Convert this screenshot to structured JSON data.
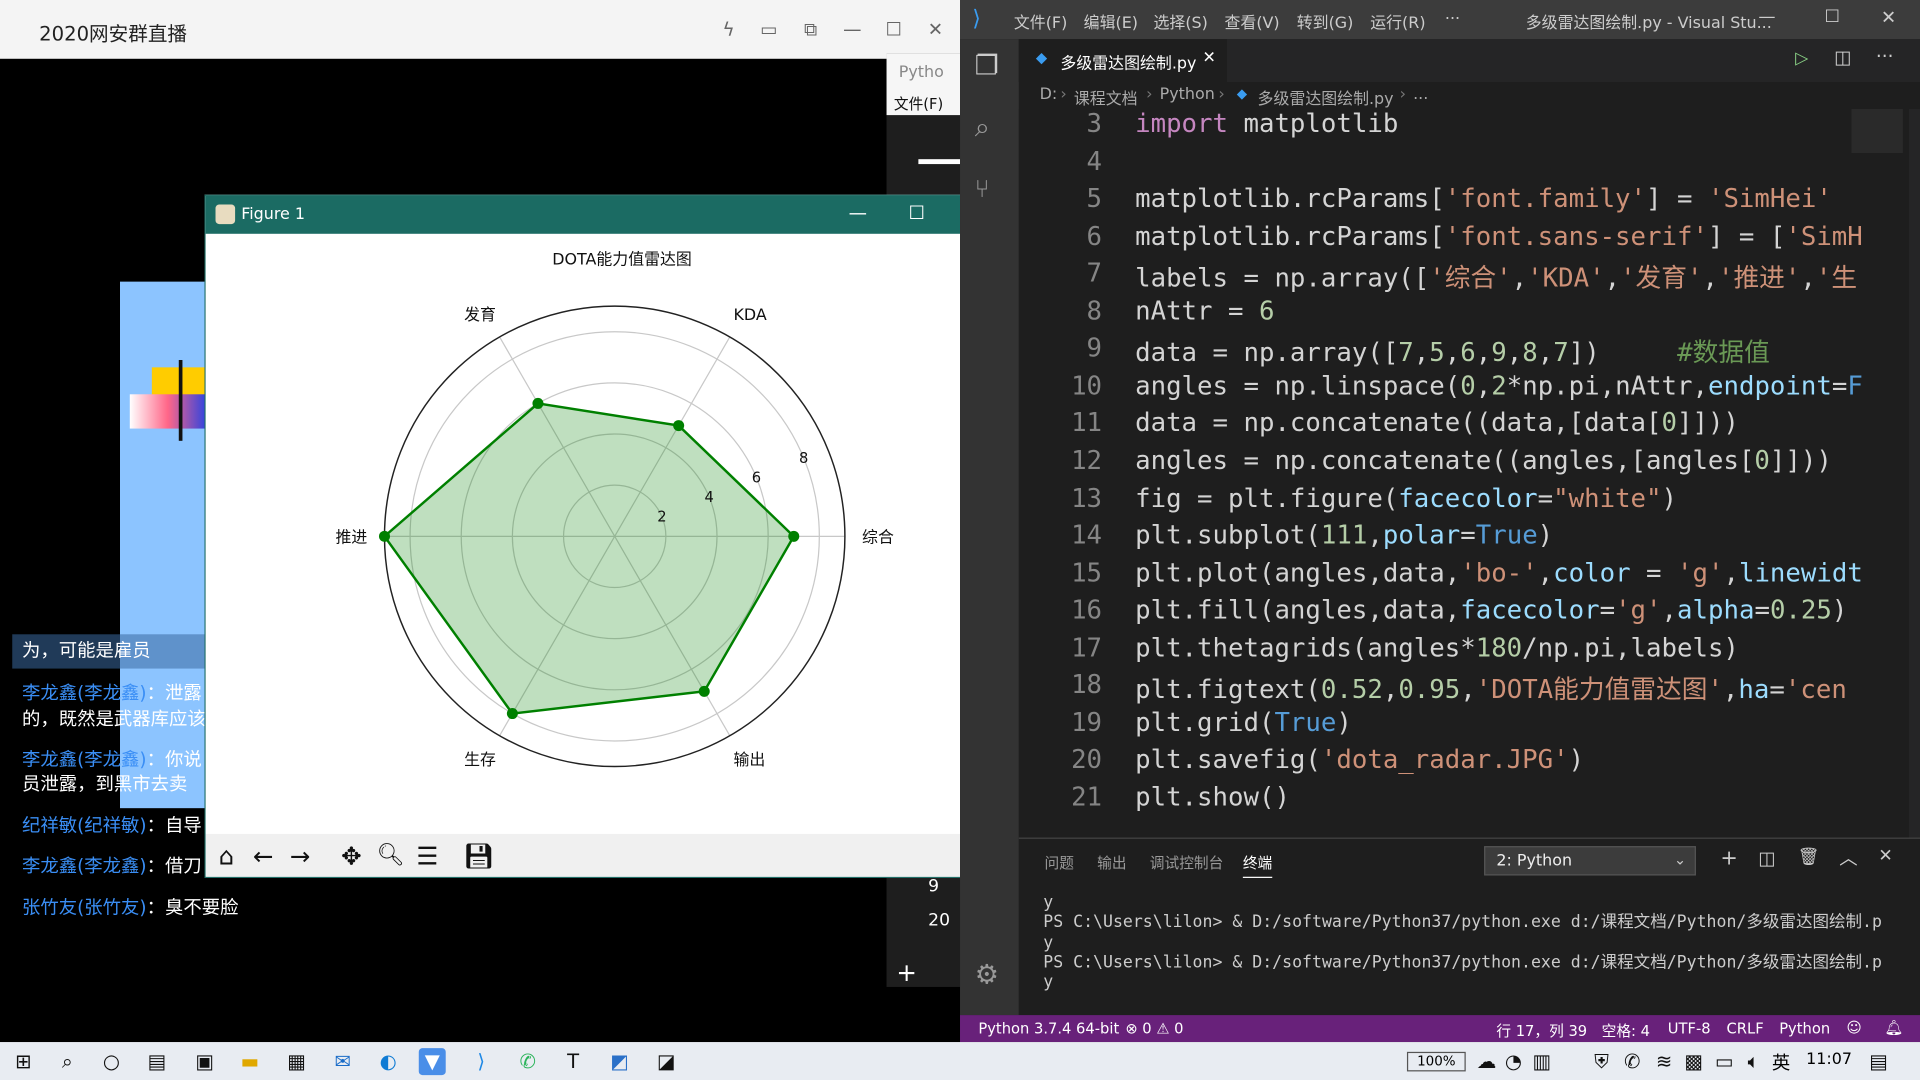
{
  "live": {
    "title": "2020网安群直播",
    "chat": [
      {
        "user": "",
        "text": "为，可能是雇员"
      },
      {
        "user": "李龙鑫(李龙鑫)",
        "text": "：泄露"
      },
      {
        "user": "",
        "text": "的，既然是武器库应该"
      },
      {
        "user": "李龙鑫(李龙鑫)",
        "text": "：你说"
      },
      {
        "user": "",
        "text": "员泄露，到黑市去卖"
      },
      {
        "user": "纪祥敏(纪祥敏)",
        "text": "：自导"
      },
      {
        "user": "李龙鑫(李龙鑫)",
        "text": "：借刀"
      },
      {
        "user": "张竹友(张竹友)",
        "text": "：臭不要脸"
      }
    ]
  },
  "python_side": {
    "tab_label": "Pytho",
    "menu": "文件(F)",
    "items": [
      "9",
      "20"
    ],
    "add": "+"
  },
  "figure": {
    "window_title": "Figure 1",
    "toolbar": [
      "home-icon",
      "back-icon",
      "forward-icon",
      "pan-icon",
      "zoom-icon",
      "configure-icon",
      "save-icon"
    ]
  },
  "chart_data": {
    "type": "radar",
    "title": "DOTA能力值雷达图",
    "categories": [
      "综合",
      "KDA",
      "发育",
      "推进",
      "生存",
      "输出"
    ],
    "values": [
      7,
      5,
      6,
      9,
      8,
      7
    ],
    "radial_ticks": [
      "2",
      "4",
      "6",
      "8"
    ],
    "rlim": [
      0,
      9.0
    ],
    "grid": true,
    "line_color": "#008000",
    "fill_color": "#008000",
    "fill_alpha": 0.25
  },
  "vscode": {
    "menu": [
      "文件(F)",
      "编辑(E)",
      "选择(S)",
      "查看(V)",
      "转到(G)",
      "运行(R)",
      "···"
    ],
    "window_title": "多级雷达图绘制.py - Visual Stu...",
    "tab": "多级雷达图绘制.py",
    "breadcrumb": [
      "D:",
      "课程文档",
      "Python",
      "多级雷达图绘制.py",
      "..."
    ],
    "lines": [
      {
        "n": "3",
        "segs": [
          [
            "kw",
            "import"
          ],
          [
            "",
            " matplotlib"
          ]
        ]
      },
      {
        "n": "4",
        "segs": []
      },
      {
        "n": "5",
        "segs": [
          [
            "",
            "matplotlib.rcParams["
          ],
          [
            "str",
            "'font.family'"
          ],
          [
            "",
            "] = "
          ],
          [
            "str",
            "'SimHei'"
          ]
        ]
      },
      {
        "n": "6",
        "segs": [
          [
            "",
            "matplotlib.rcParams["
          ],
          [
            "str",
            "'font.sans-serif'"
          ],
          [
            "",
            "] = ["
          ],
          [
            "str",
            "'SimH"
          ]
        ]
      },
      {
        "n": "7",
        "segs": [
          [
            "",
            "labels = np.array(["
          ],
          [
            "str",
            "'综合'"
          ],
          [
            "",
            ","
          ],
          [
            "str",
            "'KDA'"
          ],
          [
            "",
            ","
          ],
          [
            "str",
            "'发育'"
          ],
          [
            "",
            ","
          ],
          [
            "str",
            "'推进'"
          ],
          [
            "",
            ","
          ],
          [
            "str",
            "'生"
          ]
        ]
      },
      {
        "n": "8",
        "segs": [
          [
            "",
            "nAttr = "
          ],
          [
            "num",
            "6"
          ]
        ]
      },
      {
        "n": "9",
        "segs": [
          [
            "",
            "data = np.array(["
          ],
          [
            "num",
            "7"
          ],
          [
            "",
            ","
          ],
          [
            "num",
            "5"
          ],
          [
            "",
            ","
          ],
          [
            "num",
            "6"
          ],
          [
            "",
            ","
          ],
          [
            "num",
            "9"
          ],
          [
            "",
            ","
          ],
          [
            "num",
            "8"
          ],
          [
            "",
            ","
          ],
          [
            "num",
            "7"
          ],
          [
            "",
            "])     "
          ],
          [
            "cmt",
            "#数据值"
          ]
        ]
      },
      {
        "n": "10",
        "segs": [
          [
            "",
            "angles = np.linspace("
          ],
          [
            "num",
            "0"
          ],
          [
            "",
            ","
          ],
          [
            "num",
            "2"
          ],
          [
            "",
            "*np.pi,nAttr,"
          ],
          [
            "prm",
            "endpoint"
          ],
          [
            "",
            "="
          ],
          [
            "bool",
            "F"
          ]
        ]
      },
      {
        "n": "11",
        "segs": [
          [
            "",
            "data = np.concatenate((data,[data["
          ],
          [
            "num",
            "0"
          ],
          [
            "",
            "]]))"
          ]
        ]
      },
      {
        "n": "12",
        "segs": [
          [
            "",
            "angles = np.concatenate((angles,[angles["
          ],
          [
            "num",
            "0"
          ],
          [
            "",
            "]]))"
          ]
        ]
      },
      {
        "n": "13",
        "segs": [
          [
            "",
            "fig = plt.figure("
          ],
          [
            "prm",
            "facecolor"
          ],
          [
            "",
            "="
          ],
          [
            "str",
            "\"white\""
          ],
          [
            "",
            ")"
          ]
        ]
      },
      {
        "n": "14",
        "segs": [
          [
            "",
            "plt.subplot("
          ],
          [
            "num",
            "111"
          ],
          [
            "",
            ","
          ],
          [
            "prm",
            "polar"
          ],
          [
            "",
            "="
          ],
          [
            "bool",
            "True"
          ],
          [
            "",
            ")"
          ]
        ]
      },
      {
        "n": "15",
        "segs": [
          [
            "",
            "plt.plot(angles,data,"
          ],
          [
            "str",
            "'bo-'"
          ],
          [
            "",
            ","
          ],
          [
            "prm",
            "color"
          ],
          [
            "",
            " = "
          ],
          [
            "str",
            "'g'"
          ],
          [
            "",
            ","
          ],
          [
            "prm",
            "linewidt"
          ]
        ]
      },
      {
        "n": "16",
        "segs": [
          [
            "",
            "plt.fill(angles,data,"
          ],
          [
            "prm",
            "facecolor"
          ],
          [
            "",
            "="
          ],
          [
            "str",
            "'g'"
          ],
          [
            "",
            ","
          ],
          [
            "prm",
            "alpha"
          ],
          [
            "",
            "="
          ],
          [
            "num",
            "0.25"
          ],
          [
            "",
            ")"
          ]
        ]
      },
      {
        "n": "17",
        "segs": [
          [
            "",
            "plt.thetagrids(angles*"
          ],
          [
            "num",
            "180"
          ],
          [
            "",
            "/np.pi,labels)"
          ]
        ]
      },
      {
        "n": "18",
        "segs": [
          [
            "",
            "plt.figtext("
          ],
          [
            "num",
            "0.52"
          ],
          [
            "",
            ","
          ],
          [
            "num",
            "0.95"
          ],
          [
            "",
            ","
          ],
          [
            "str",
            "'DOTA能力值雷达图'"
          ],
          [
            "",
            ","
          ],
          [
            "prm",
            "ha"
          ],
          [
            "",
            "="
          ],
          [
            "str",
            "'cen"
          ]
        ]
      },
      {
        "n": "19",
        "segs": [
          [
            "",
            "plt.grid("
          ],
          [
            "bool",
            "True"
          ],
          [
            "",
            ")"
          ]
        ]
      },
      {
        "n": "20",
        "segs": [
          [
            "",
            "plt.savefig("
          ],
          [
            "str",
            "'dota_radar.JPG'"
          ],
          [
            "",
            ")"
          ]
        ]
      },
      {
        "n": "21",
        "segs": [
          [
            "",
            "plt.show()"
          ]
        ]
      }
    ],
    "panel_tabs": [
      "问题",
      "输出",
      "调试控制台",
      "终端"
    ],
    "terminal_select": "2: Python",
    "terminal": [
      "y",
      "PS C:\\Users\\lilon> & D:/software/Python37/python.exe d:/课程文档/Python/多级雷达图绘制.p",
      "y",
      "PS C:\\Users\\lilon> & D:/software/Python37/python.exe d:/课程文档/Python/多级雷达图绘制.p",
      "y"
    ],
    "status": {
      "interpreter": "Python 3.7.4 64-bit",
      "problems": "⊗ 0 ⚠ 0",
      "position": "行 17，列 39",
      "spaces": "空格: 4",
      "encoding": "UTF-8",
      "eol": "CRLF",
      "language": "Python"
    }
  },
  "taskbar": {
    "battery": "100%",
    "ime": "英",
    "time": "11:07"
  }
}
